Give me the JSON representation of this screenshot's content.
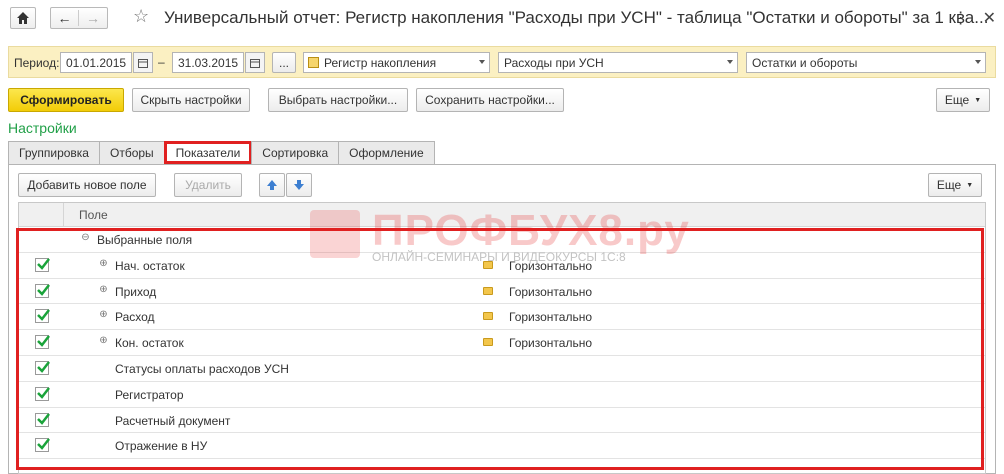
{
  "window": {
    "title": "Универсальный отчет: Регистр накопления \"Расходы при УСН\" - таблица \"Остатки и обороты\" за 1 ква...",
    "more_icon": "⋮",
    "close_icon": "✕"
  },
  "period": {
    "label": "Период:",
    "from": "01.01.2015",
    "dash": "–",
    "to": "31.03.2015",
    "more_btn": "...",
    "source_type": "Регистр накопления",
    "source_name": "Расходы при УСН",
    "table_kind": "Остатки и обороты"
  },
  "toolbar": {
    "generate": "Сформировать",
    "hide_settings": "Скрыть настройки",
    "choose_settings": "Выбрать настройки...",
    "save_settings": "Сохранить настройки...",
    "more": "Еще"
  },
  "settings": {
    "label": "Настройки",
    "tabs": [
      "Группировка",
      "Отборы",
      "Показатели",
      "Сортировка",
      "Оформление"
    ],
    "active_tab": "Показатели"
  },
  "fields_toolbar": {
    "add_field": "Добавить новое поле",
    "delete": "Удалить",
    "more": "Еще"
  },
  "grid": {
    "column": "Поле",
    "root": "Выбранные поля",
    "rows": [
      {
        "name": "Нач. остаток",
        "group": "Горизонтально",
        "checked": true,
        "expandable": true
      },
      {
        "name": "Приход",
        "group": "Горизонтально",
        "checked": true,
        "expandable": true
      },
      {
        "name": "Расход",
        "group": "Горизонтально",
        "checked": true,
        "expandable": true
      },
      {
        "name": "Кон. остаток",
        "group": "Горизонтально",
        "checked": true,
        "expandable": true
      },
      {
        "name": "Статусы оплаты расходов УСН",
        "group": "",
        "checked": true,
        "expandable": false
      },
      {
        "name": "Регистратор",
        "group": "",
        "checked": true,
        "expandable": false
      },
      {
        "name": "Расчетный документ",
        "group": "",
        "checked": true,
        "expandable": false
      },
      {
        "name": "Отражение в НУ",
        "group": "",
        "checked": true,
        "expandable": false
      }
    ]
  },
  "watermark": {
    "brand": "ПРОФБУХ8.ру",
    "subtitle": "ОНЛАЙН-СЕМИНАРЫ И ВИДЕОКУРСЫ 1С:8"
  },
  "colors": {
    "accent_green": "#21a048",
    "highlight_red": "#e02020",
    "period_bg": "#fbf0c2",
    "primary_button": "#f2cc07"
  }
}
